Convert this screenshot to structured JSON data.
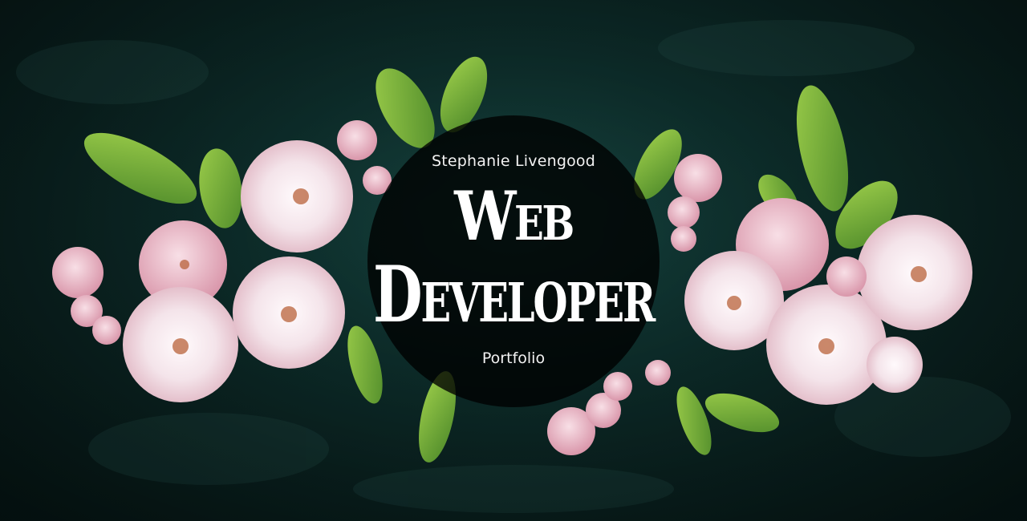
{
  "hero": {
    "name": "Stephanie Livengood",
    "title_line_1": "Web",
    "title_line_2": "Developer",
    "subtitle": "Portfolio",
    "background_color": "#0c2b2a",
    "medallion_color": "#000000",
    "text_color": "#ffffff"
  }
}
